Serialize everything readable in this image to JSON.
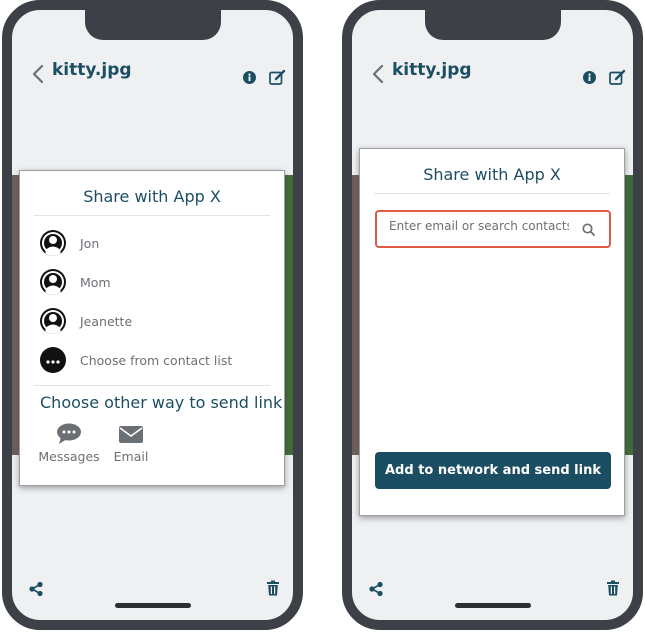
{
  "colors": {
    "brand": "#1c4e63",
    "frame": "#3d4046",
    "accent_error": "#e05a46",
    "muted_text": "#6b7075"
  },
  "screen_left": {
    "header": {
      "title": "kitty.jpg",
      "icons": [
        "back-chevron-icon",
        "info-icon",
        "edit-icon"
      ]
    },
    "share_dialog": {
      "title": "Share with App X",
      "contacts": [
        {
          "label": "Jon",
          "icon": "user-avatar-icon"
        },
        {
          "label": "Mom",
          "icon": "user-avatar-icon"
        },
        {
          "label": "Jeanette",
          "icon": "user-avatar-icon"
        },
        {
          "label": "Choose from contact list",
          "icon": "more-contacts-icon"
        }
      ],
      "other_heading": "Choose other way to send link",
      "send_options": [
        {
          "label": "Messages",
          "icon": "message-bubble-icon"
        },
        {
          "label": "Email",
          "icon": "envelope-icon"
        }
      ]
    },
    "footer": {
      "icons": [
        "share-icon",
        "trash-icon"
      ]
    }
  },
  "screen_right": {
    "header": {
      "title": "kitty.jpg",
      "icons": [
        "back-chevron-icon",
        "info-icon",
        "edit-icon"
      ]
    },
    "share_dialog": {
      "title": "Share with App X",
      "search": {
        "placeholder": "Enter email or search contacts",
        "value": "",
        "icon": "search-icon"
      },
      "primary_button": "Add to network and send link"
    },
    "footer": {
      "icons": [
        "share-icon",
        "trash-icon"
      ]
    }
  }
}
